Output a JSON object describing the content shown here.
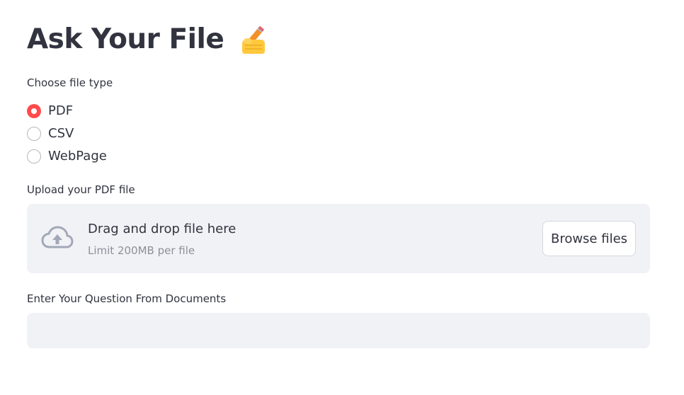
{
  "app": {
    "title": "Ask Your File",
    "title_emoji": "writing-hand-icon"
  },
  "file_type": {
    "label": "Choose file type",
    "options": [
      {
        "label": "PDF",
        "selected": true
      },
      {
        "label": "CSV",
        "selected": false
      },
      {
        "label": "WebPage",
        "selected": false
      }
    ]
  },
  "uploader": {
    "label": "Upload your PDF file",
    "drop_text": "Drag and drop file here",
    "limit_text": "Limit 200MB per file",
    "browse_label": "Browse files",
    "icon": "cloud-upload-icon"
  },
  "question": {
    "label": "Enter Your Question From Documents",
    "value": "",
    "placeholder": ""
  },
  "colors": {
    "accent": "#ff4b4b",
    "text": "#31333f",
    "muted": "#8e9099",
    "field_bg": "#f0f2f6",
    "icon": "#a3a8b8"
  }
}
